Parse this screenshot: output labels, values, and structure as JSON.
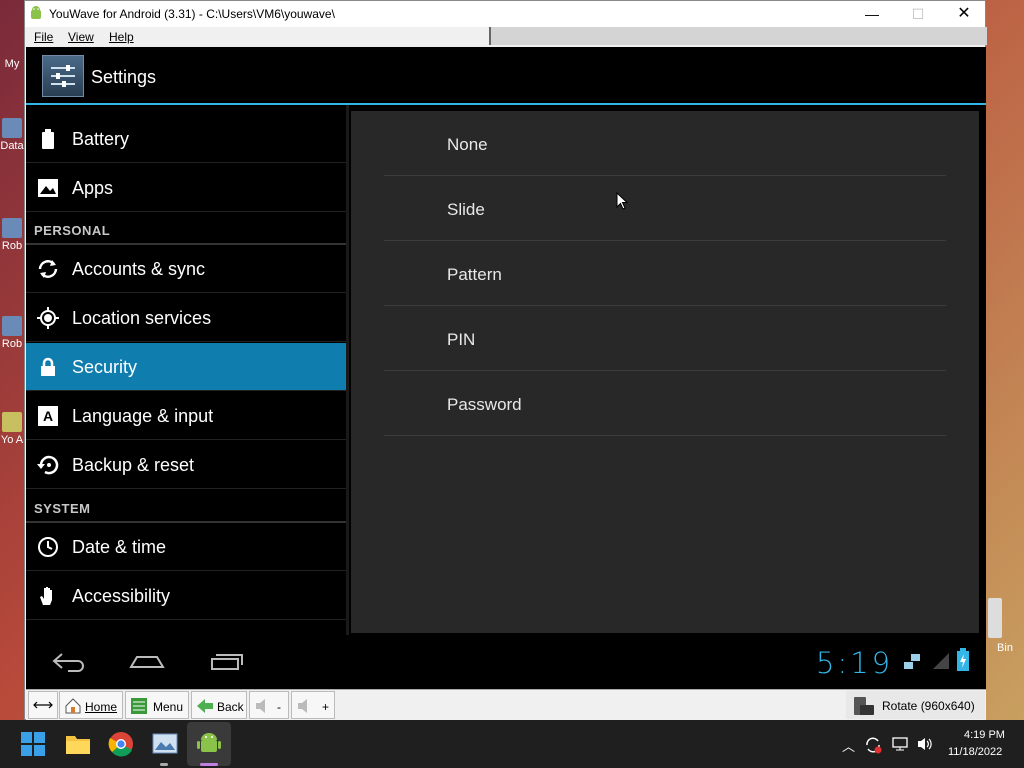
{
  "window": {
    "title": "YouWave for Android (3.31) - C:\\Users\\VM6\\youwave\\",
    "minimize": "—",
    "maximize": "☐",
    "close": "✕"
  },
  "menu": {
    "file": "File",
    "view": "View",
    "help": "Help"
  },
  "action_bar": {
    "title": "Settings",
    "icon": "settings-icon"
  },
  "sections": {
    "personal": "PERSONAL",
    "system": "SYSTEM"
  },
  "left_items": [
    {
      "label": "Battery",
      "icon": "battery-icon"
    },
    {
      "label": "Apps",
      "icon": "apps-icon"
    },
    {
      "label": "Accounts & sync",
      "icon": "sync-icon"
    },
    {
      "label": "Location services",
      "icon": "location-icon"
    },
    {
      "label": "Security",
      "icon": "lock-icon",
      "selected": true
    },
    {
      "label": "Language & input",
      "icon": "language-icon"
    },
    {
      "label": "Backup & reset",
      "icon": "backup-icon"
    },
    {
      "label": "Date & time",
      "icon": "clock-icon"
    },
    {
      "label": "Accessibility",
      "icon": "hand-icon"
    }
  ],
  "options": [
    "None",
    "Slide",
    "Pattern",
    "PIN",
    "Password"
  ],
  "status": {
    "time": "5:19"
  },
  "toolbar": {
    "home": "Home",
    "menu": "Menu",
    "back": "Back",
    "vol_down": "-",
    "vol_up": "+",
    "rotate": "Rotate (960x640)"
  },
  "desktop": {
    "icon1": "My",
    "icon2": "Data",
    "icon3": "Rob",
    "icon4": "Rob",
    "icon5": "Yo A",
    "recycle": "Bin"
  },
  "taskbar": {
    "time": "4:19 PM",
    "date": "11/18/2022"
  },
  "colors": {
    "accent": "#33b5e5",
    "selected": "#0f7dae"
  }
}
